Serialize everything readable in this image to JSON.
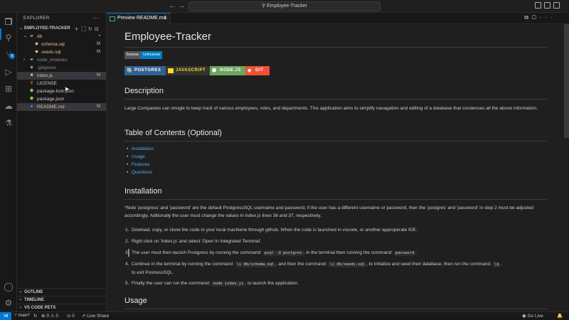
{
  "titlebar": {
    "search_text": "Employee-Tracker",
    "nav_back": "←",
    "nav_forward": "→"
  },
  "sidebar": {
    "title": "EXPLORER",
    "section": "EMPLOYEE-TRACKER",
    "tree": [
      {
        "label": "db",
        "type": "folder-open",
        "badge": "•"
      },
      {
        "label": "schema.sql",
        "type": "sql",
        "badge": "M"
      },
      {
        "label": "seeds.sql",
        "type": "sql",
        "badge": "M"
      },
      {
        "label": "node_modules",
        "type": "folder",
        "badge": ""
      },
      {
        "label": ".gitignore",
        "type": "git",
        "badge": ""
      },
      {
        "label": "index.js",
        "type": "js",
        "badge": "M"
      },
      {
        "label": "LICENSE",
        "type": "license",
        "badge": ""
      },
      {
        "label": "package-lock.json",
        "type": "json",
        "badge": ""
      },
      {
        "label": "package.json",
        "type": "json",
        "badge": ""
      },
      {
        "label": "README.md",
        "type": "md",
        "badge": "M"
      }
    ],
    "bottom_sections": [
      "OUTLINE",
      "TIMELINE",
      "VS CODE PETS"
    ]
  },
  "tabs": [
    {
      "label": "Preview README.md"
    }
  ],
  "readme": {
    "title": "Employee-Tracker",
    "license_badge": {
      "left": "license",
      "right": "Unlicense"
    },
    "tech_badges": [
      "POSTGRES",
      "JAVASCRIPT",
      "NODE.JS",
      "GIT"
    ],
    "description_heading": "Description",
    "description_text": "Large Companies can strugle to keep track of various employees, roles, and departments. This application aims to simplify navagation and editing of a database that condenses all the above information.",
    "toc_heading": "Table of Contents (Optional)",
    "toc": [
      "Installation",
      "Usage",
      "Features",
      "Questions"
    ],
    "installation_heading": "Installation",
    "installation_note": "*Note 'postgress' and 'password' are the default PostgressSQL username and password, if the user has a different username or password, then the 'postgres' and 'password' in step 2 must be adjusted accordingly. Aditionally the user must change the values in index.js lines 36 and 37, respectively.",
    "steps": {
      "s1": "Dowload, copy, or clone the code to your local machiene through github. When the code is launched in vscode, or another approperate IDE.",
      "s2": "Right click on 'index.js' and select 'Open In Integrated Terminal'.",
      "s3_a": "The user must then launch Postgress by running the command: ",
      "s3_code1": "psql -U postgres",
      "s3_b": ", in the terminal then running the command: ",
      "s3_code2": "password",
      "s3_c": ".",
      "s4_a": "Continue in the terminal by running the command: ",
      "s4_code1": "\\i db/schema.sql",
      "s4_b": ", and then the command: ",
      "s4_code2": "\\i db/seeds.sql",
      "s4_c": ", to initialize and seed their database, then run the command: ",
      "s4_code3": "\\q",
      "s4_d": ",",
      "s4_e": "to exit PostressSQL.",
      "s5_a": "Finally the user can run the command: ",
      "s5_code": "node index.js",
      "s5_b": ", to launch the application."
    },
    "usage_heading": "Usage"
  },
  "statusbar": {
    "branch": "main*",
    "errors": "0",
    "warnings": "0",
    "ports": "0",
    "live_share": "Live Share",
    "go_live": "Go Live"
  }
}
